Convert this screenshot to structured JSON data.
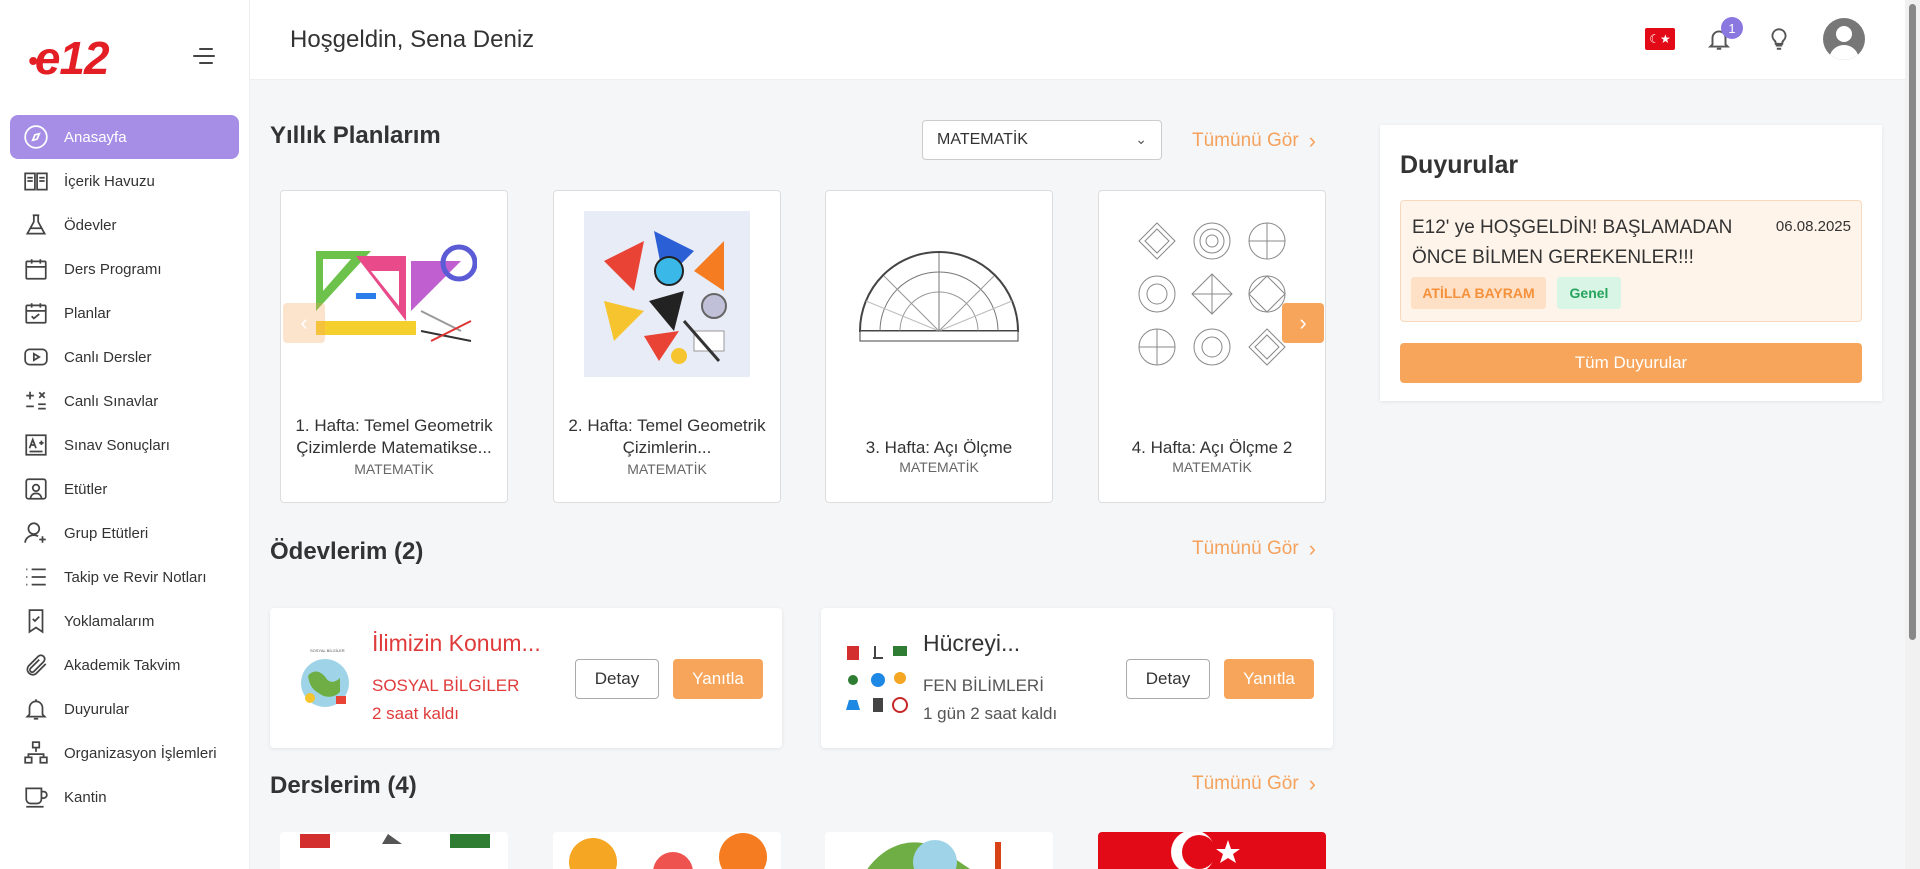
{
  "header": {
    "greeting": "Hoşgeldin, Sena Deniz",
    "notification_count": "1",
    "flag_symbol": "☾★"
  },
  "brand": {
    "logo_text": "e12"
  },
  "sidebar": {
    "items": [
      {
        "label": "Anasayfa",
        "icon": "compass-icon"
      },
      {
        "label": "İçerik Havuzu",
        "icon": "book-open-icon"
      },
      {
        "label": "Ödevler",
        "icon": "flask-icon"
      },
      {
        "label": "Ders Programı",
        "icon": "calendar-icon"
      },
      {
        "label": "Planlar",
        "icon": "calendar-check-icon"
      },
      {
        "label": "Canlı Dersler",
        "icon": "play-icon"
      },
      {
        "label": "Canlı Sınavlar",
        "icon": "math-ops-icon"
      },
      {
        "label": "Sınav Sonuçları",
        "icon": "grade-icon"
      },
      {
        "label": "Etütler",
        "icon": "presentation-icon"
      },
      {
        "label": "Grup Etütleri",
        "icon": "user-add-icon"
      },
      {
        "label": "Takip ve Revir Notları",
        "icon": "list-icon"
      },
      {
        "label": "Yoklamalarım",
        "icon": "bookmark-check-icon"
      },
      {
        "label": "Akademik Takvim",
        "icon": "paperclip-icon"
      },
      {
        "label": "Duyurular",
        "icon": "bell-icon"
      },
      {
        "label": "Organizasyon İşlemleri",
        "icon": "sitemap-icon"
      },
      {
        "label": "Kantin",
        "icon": "cup-icon"
      }
    ]
  },
  "plans": {
    "title": "Yıllık Planlarım",
    "subject_filter": "MATEMATİK",
    "see_all": "Tümünü Gör",
    "cards": [
      {
        "title": "1. Hafta: Temel Geometrik Çizimlerde Matematikse...",
        "subject": "MATEMATİK"
      },
      {
        "title": "2. Hafta: Temel Geometrik Çizimlerin...",
        "subject": "MATEMATİK"
      },
      {
        "title": "3. Hafta: Açı Ölçme",
        "subject": "MATEMATİK"
      },
      {
        "title": "4. Hafta: Açı Ölçme 2",
        "subject": "MATEMATİK"
      }
    ]
  },
  "homework": {
    "title": "Ödevlerim (2)",
    "see_all": "Tümünü Gör",
    "items": [
      {
        "title": "İlimizin Konum...",
        "subject": "SOSYAL BİLGİLER",
        "time_left": "2 saat kaldı",
        "detail": "Detay",
        "reply": "Yanıtla"
      },
      {
        "title": "Hücreyi...",
        "subject": "FEN BİLİMLERİ",
        "time_left": "1 gün 2 saat kaldı",
        "detail": "Detay",
        "reply": "Yanıtla"
      }
    ]
  },
  "courses": {
    "title": "Derslerim (4)",
    "see_all": "Tümünü Gör"
  },
  "announcements": {
    "title": "Duyurular",
    "items": [
      {
        "text": "E12' ye HOŞGELDİN! BAŞLAMADAN ÖNCE BİLMEN GEREKENLER!!!",
        "date": "06.08.2025",
        "author": "ATİLLA BAYRAM",
        "category": "Genel"
      }
    ],
    "all_button": "Tüm Duyurular"
  },
  "colors": {
    "accent_orange": "#f7a55a",
    "active_purple": "#a68ee6",
    "brand_red": "#e41e25",
    "overdue_red": "#e03b3b"
  }
}
